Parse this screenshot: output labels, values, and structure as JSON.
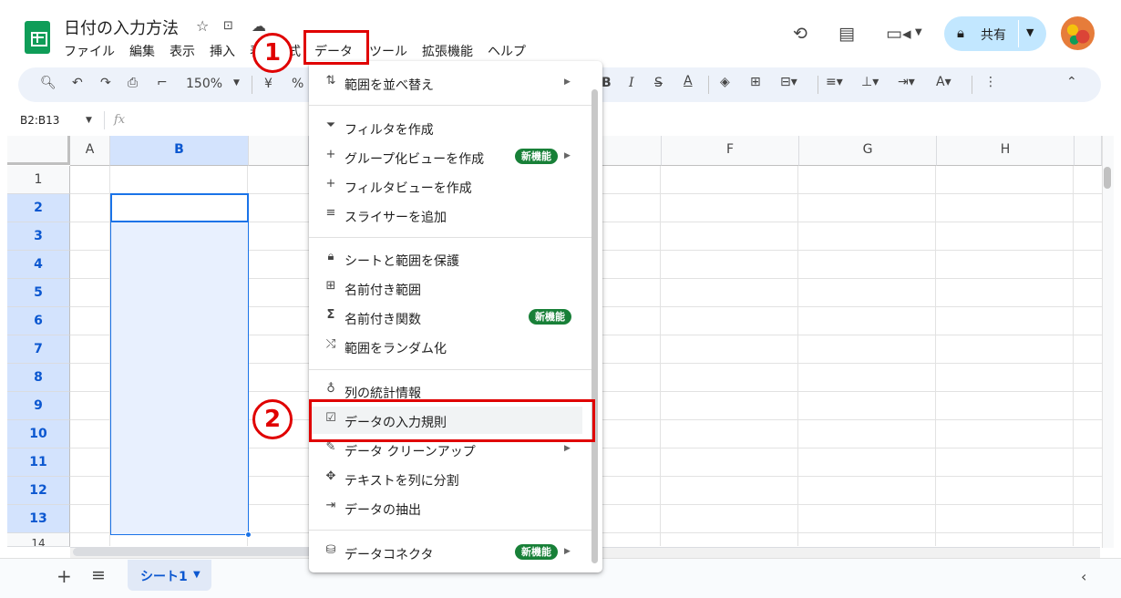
{
  "header": {
    "title": "日付の入力方法",
    "menu": [
      "ファイル",
      "編集",
      "表示",
      "挿入",
      "表示形式",
      "データ",
      "ツール",
      "拡張機能",
      "ヘルプ"
    ],
    "share_label": "共有"
  },
  "toolbar": {
    "zoom": "150%",
    "currency": "¥",
    "percent": "%"
  },
  "formula_bar": {
    "name_box": "B2:B13",
    "fx": "fx"
  },
  "grid": {
    "columns": [
      "A",
      "B",
      "F",
      "G",
      "H"
    ],
    "rows": [
      "1",
      "2",
      "3",
      "4",
      "5",
      "6",
      "7",
      "8",
      "9",
      "10",
      "11",
      "12",
      "13",
      "14"
    ],
    "selected_column": "B"
  },
  "sheet_tab": "シート1",
  "data_menu": {
    "items": [
      {
        "label": "範囲を並べ替え",
        "icon": "sort-icon"
      },
      {
        "label": "フィルタを作成",
        "icon": "filter-icon"
      },
      {
        "label": "グループ化ビューを作成",
        "icon": "plus-icon",
        "badge": "新機能"
      },
      {
        "label": "フィルタビューを作成",
        "icon": "plus-icon"
      },
      {
        "label": "スライサーを追加",
        "icon": "slicer-icon"
      },
      {
        "label": "シートと範囲を保護",
        "icon": "lock-icon"
      },
      {
        "label": "名前付き範囲",
        "icon": "named-range-icon"
      },
      {
        "label": "名前付き関数",
        "icon": "sigma-icon",
        "badge": "新機能"
      },
      {
        "label": "範囲をランダム化",
        "icon": "shuffle-icon"
      },
      {
        "label": "列の統計情報",
        "icon": "bulb-icon"
      },
      {
        "label": "データの入力規則",
        "icon": "validation-icon"
      },
      {
        "label": "データ クリーンアップ",
        "icon": "wand-icon"
      },
      {
        "label": "テキストを列に分割",
        "icon": "split-icon"
      },
      {
        "label": "データの抽出",
        "icon": "extract-icon"
      },
      {
        "label": "データコネクタ",
        "icon": "database-icon",
        "badge": "新機能"
      }
    ]
  },
  "annotations": {
    "step1": "1",
    "step2": "2"
  },
  "colors": {
    "accent": "#1a73e8",
    "annotation_red": "#e00000",
    "badge_green": "#188038",
    "share_button": "#c2e7ff"
  }
}
